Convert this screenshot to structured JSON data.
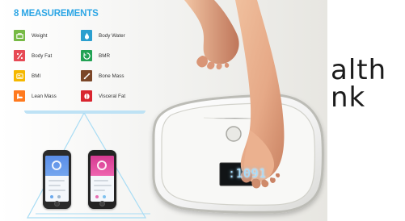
{
  "image": {
    "panel_title": "8 MEASUREMENTS",
    "scale_display": ":1091",
    "overlay_text": {
      "line_1": "alth",
      "line_2": "nk"
    },
    "colors": {
      "title_blue": "#2da6e5",
      "weight_green": "#77ba45",
      "body_fat_red": "#e74a55",
      "bmi_yellow": "#f5b800",
      "lean_mass_orange": "#ff7a1f",
      "body_water_blue": "#2b9fcf",
      "bmr_green": "#22a254",
      "bone_mass_brown": "#7b4628",
      "visceral_fat_red": "#d9252f",
      "phone_blue": "#5a8ee8",
      "phone_pink": "#d53a91",
      "display_blue": "#9fdcff"
    }
  },
  "measurements": [
    {
      "label": "Weight",
      "icon": "weight-icon",
      "color": "#77ba45"
    },
    {
      "label": "Body Fat",
      "icon": "body-fat-icon",
      "color": "#e74a55"
    },
    {
      "label": "BMI",
      "icon": "bmi-icon",
      "color": "#f5b800"
    },
    {
      "label": "Lean Mass",
      "icon": "lean-mass-icon",
      "color": "#ff7a1f"
    },
    {
      "label": "Body Water",
      "icon": "body-water-icon",
      "color": "#2b9fcf"
    },
    {
      "label": "BMR",
      "icon": "bmr-icon",
      "color": "#22a254"
    },
    {
      "label": "Bone Mass",
      "icon": "bone-mass-icon",
      "color": "#7b4628"
    },
    {
      "label": "Visceral Fat",
      "icon": "visceral-fat-icon",
      "color": "#d9252f"
    }
  ]
}
